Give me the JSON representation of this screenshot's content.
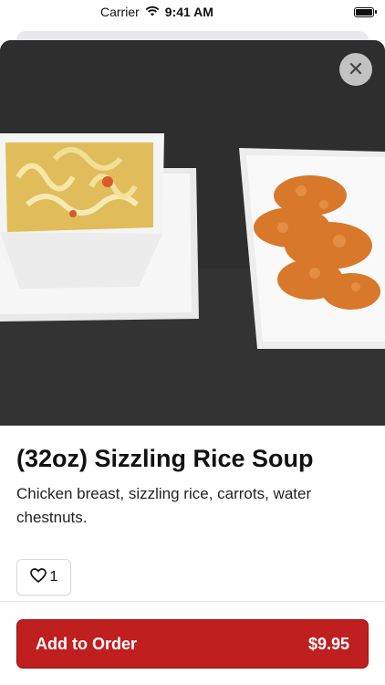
{
  "status_bar": {
    "carrier": "Carrier",
    "time": "9:41 AM"
  },
  "item": {
    "title": "(32oz) Sizzling Rice Soup",
    "description": "Chicken breast, sizzling rice, carrots, water chestnuts.",
    "like_count": "1"
  },
  "actions": {
    "close_glyph": "✕",
    "add_label": "Add to Order",
    "price": "$9.95"
  },
  "colors": {
    "accent": "#bf1f1f"
  },
  "icons": [
    "wifi-icon",
    "battery-icon",
    "close-icon",
    "heart-icon"
  ]
}
